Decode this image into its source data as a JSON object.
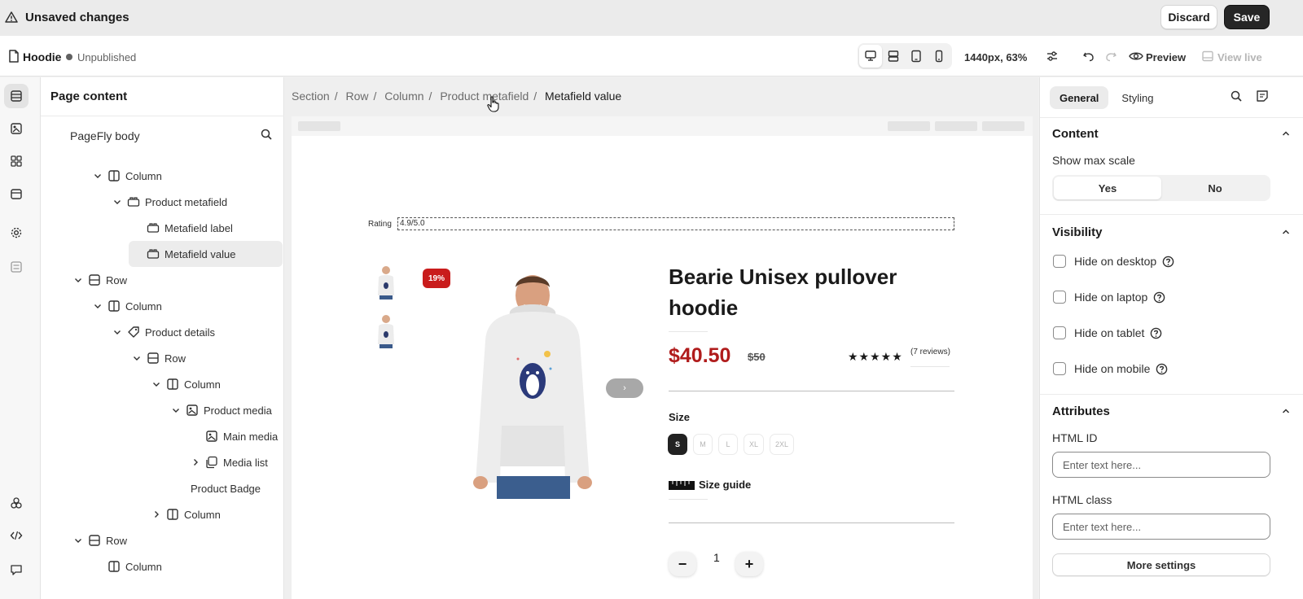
{
  "topbar": {
    "title": "Unsaved changes",
    "discard_label": "Discard",
    "save_label": "Save"
  },
  "subbar": {
    "page_name": "Hoodie",
    "status": "Unpublished",
    "viewport": "1440px, 63%",
    "preview_label": "Preview",
    "view_live_label": "View live"
  },
  "panel": {
    "title": "Page content",
    "body_label": "PageFly body",
    "tree": [
      {
        "label": "Column",
        "icon": "column-icon"
      },
      {
        "label": "Product metafield",
        "icon": "metafield-icon"
      },
      {
        "label": "Metafield label",
        "icon": "metafield-icon"
      },
      {
        "label": "Metafield value",
        "icon": "metafield-icon"
      },
      {
        "label": "Row",
        "icon": "row-icon"
      },
      {
        "label": "Column",
        "icon": "column-icon"
      },
      {
        "label": "Product details",
        "icon": "tag-icon"
      },
      {
        "label": "Row",
        "icon": "row-icon"
      },
      {
        "label": "Column",
        "icon": "column-icon"
      },
      {
        "label": "Product media",
        "icon": "media-icon"
      },
      {
        "label": "Main media",
        "icon": "media-icon"
      },
      {
        "label": "Media list",
        "icon": "media-list-icon"
      },
      {
        "label": "Product Badge",
        "icon": ""
      },
      {
        "label": "Column",
        "icon": "column-icon"
      },
      {
        "label": "Row",
        "icon": "row-icon"
      },
      {
        "label": "Column",
        "icon": "column-icon"
      }
    ]
  },
  "breadcrumb": [
    "Section",
    "Row",
    "Column",
    "Product metafield",
    "Metafield value"
  ],
  "product": {
    "rating_label": "Rating",
    "rating_value": "4.9/5.0",
    "badge": "19%",
    "title": "Bearie Unisex pullover hoodie",
    "price": "$40.50",
    "compare_price": "$50",
    "stars": "★★★★★",
    "reviews": "(7 reviews)",
    "size_label": "Size",
    "sizes": [
      "S",
      "M",
      "L",
      "XL",
      "2XL"
    ],
    "size_guide": "Size guide",
    "quantity": "1",
    "minus": "−",
    "plus": "+",
    "next_arrow": "›"
  },
  "rpanel": {
    "tabs": [
      "General",
      "Styling"
    ],
    "content_title": "Content",
    "show_max_scale": "Show max scale",
    "seg_yes": "Yes",
    "seg_no": "No",
    "visibility_title": "Visibility",
    "visibility": [
      "Hide on desktop",
      "Hide on laptop",
      "Hide on tablet",
      "Hide on mobile"
    ],
    "attributes_title": "Attributes",
    "html_id_label": "HTML ID",
    "html_class_label": "HTML class",
    "placeholder": "Enter text here...",
    "more_settings": "More settings"
  },
  "colors": {
    "accent_dark": "#262626",
    "price_red": "#b01c1c",
    "badge_red": "#c91c1c"
  }
}
